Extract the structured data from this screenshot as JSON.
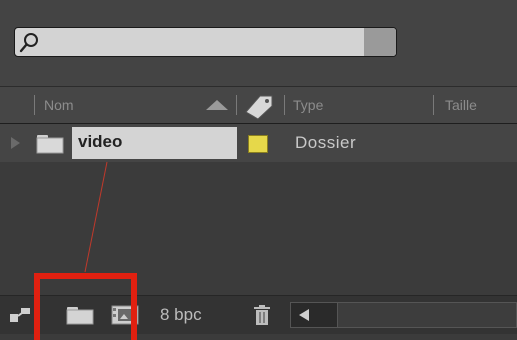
{
  "search": {
    "value": "",
    "placeholder": ""
  },
  "columns": [
    {
      "label": "Nom"
    },
    {
      "label": "Type"
    },
    {
      "label": "Taille"
    }
  ],
  "rows": [
    {
      "name": "video",
      "type": "Dossier",
      "label_color": "#e6d84a"
    }
  ],
  "toolbar": {
    "bit_depth": "8 bpc"
  },
  "icons": {
    "search": "search-icon",
    "sort": "sort-ascending-icon",
    "label": "label-tag-icon",
    "expand": "disclosure-triangle-icon",
    "folder": "folder-icon",
    "flowchart": "flowchart-icon",
    "new_folder": "new-folder-icon",
    "new_comp": "new-composition-icon",
    "trash": "trash-icon",
    "scroll_left": "scroll-left-arrow-icon"
  },
  "annotation": {
    "color": "#e02010"
  }
}
